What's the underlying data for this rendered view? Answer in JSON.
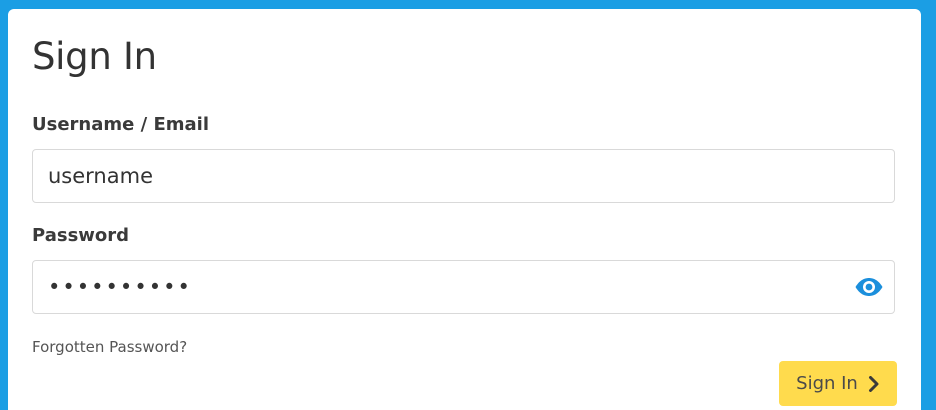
{
  "form": {
    "title": "Sign In",
    "username_label": "Username / Email",
    "username_value": "username",
    "password_label": "Password",
    "password_value": "••••••••••",
    "forgot_link": "Forgotten Password?",
    "submit_label": "Sign In"
  },
  "icons": {
    "password_toggle": "eye-icon",
    "submit_arrow": "chevron-right-icon"
  },
  "colors": {
    "background": "#1b9ee4",
    "card": "#ffffff",
    "button": "#ffdb4d",
    "eye_icon": "#1b8fdc"
  }
}
